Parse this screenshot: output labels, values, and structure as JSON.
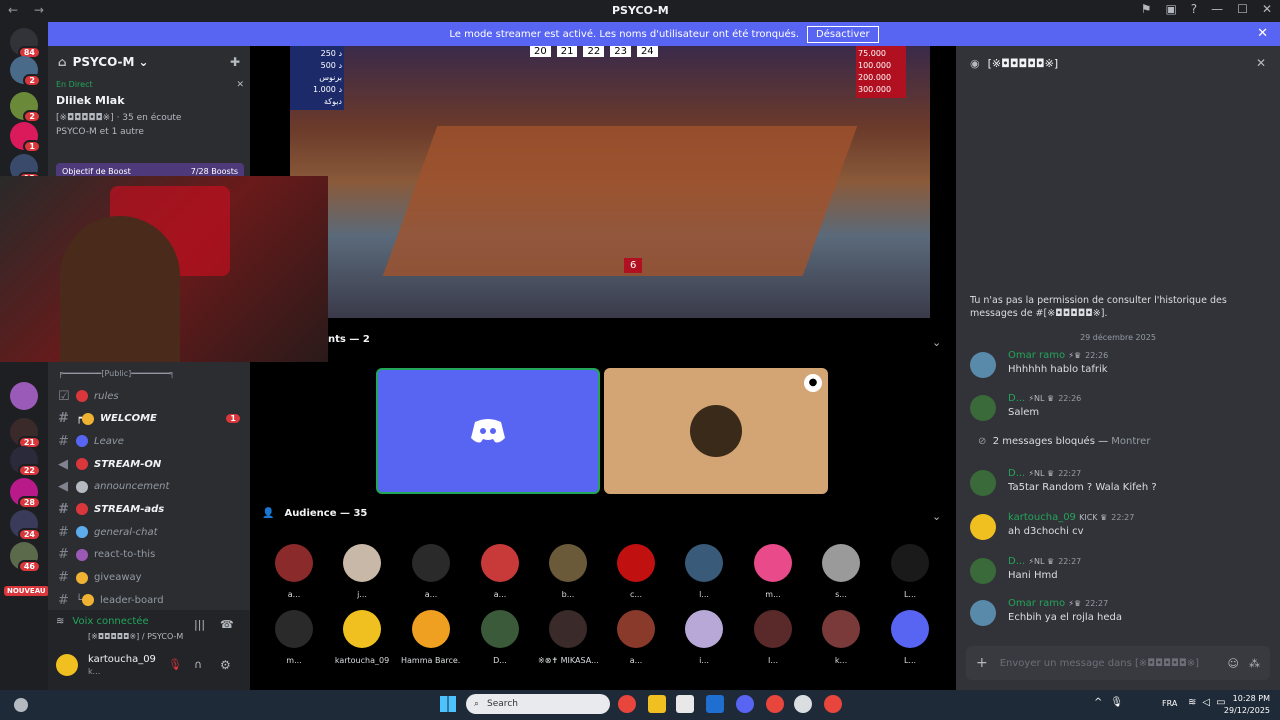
{
  "window": {
    "title": "PSYCO-M",
    "back": "←",
    "forward": "→"
  },
  "banner": {
    "text": "Le mode streamer est activé. Les noms d'utilisateur ont été tronqués.",
    "button": "Désactiver"
  },
  "guild_badges": [
    "84",
    "2",
    "2",
    "1",
    "13",
    "21",
    "22",
    "28",
    "24",
    "46"
  ],
  "guild_new_label": "NOUVEAU",
  "server": {
    "name": "PSYCO-M",
    "live_label": "En Direct",
    "event_title": "Dlilek Mlak",
    "event_channel": "[※◘◘◘◘◘※]",
    "listening": "35 en écoute",
    "hosts": "PSYCO-M et 1 autre",
    "boost_label": "Objectif de Boost",
    "boost_count": "7/28 Boosts"
  },
  "channels": [
    {
      "prefix": "╒━━━━━━━━[Public]━━━━━━━━╕",
      "label": "",
      "type": "category"
    },
    {
      "prefix": "",
      "label": "rules",
      "emoji_color": "#da373c",
      "type": "rules"
    },
    {
      "prefix": "┍",
      "label": "WELCOME",
      "emoji_color": "#f0b232",
      "bold": true,
      "ping": "1"
    },
    {
      "prefix": "",
      "label": "Leave",
      "emoji_color": "#5865f2"
    },
    {
      "prefix": "",
      "label": "STREAM-ON",
      "emoji_color": "#da373c",
      "bold": true,
      "type": "announce"
    },
    {
      "prefix": "",
      "label": "announcement",
      "emoji_color": "#b5bac1",
      "type": "announce"
    },
    {
      "prefix": "",
      "label": "STREAM-ads",
      "emoji_color": "#da373c",
      "bold": true
    },
    {
      "prefix": "",
      "label": "general-chat",
      "emoji_color": "#5dadec"
    },
    {
      "prefix": "",
      "label": "react-to-this",
      "emoji_color": "#9b59b6"
    },
    {
      "prefix": "",
      "label": "giveaway",
      "emoji_color": "#f0b232"
    },
    {
      "prefix": "└",
      "label": "leader-board",
      "emoji_color": "#f0b232"
    }
  ],
  "voice": {
    "status": "Voix connectée",
    "channel": "[※◘◘◘◘◘※] / PSYCO-M"
  },
  "user": {
    "name": "kartoucha_09",
    "status": "k..."
  },
  "stream": {
    "left_scores": [
      "250 د",
      "500 د",
      "برنوس",
      "1.000 د",
      "دبوكة"
    ],
    "right_scores": [
      "75.000",
      "100.000",
      "200.000",
      "300.000"
    ],
    "numbers": [
      "20",
      "21",
      "22",
      "23",
      "24"
    ],
    "podium": "6"
  },
  "participants_label": "nts — 2",
  "audience_label": "Audience — 35",
  "audience": [
    {
      "name": "a...",
      "color": "#8a2a2a"
    },
    {
      "name": "j...",
      "color": "#c8b8a8"
    },
    {
      "name": "a...",
      "color": "#2a2a2a"
    },
    {
      "name": "a...",
      "color": "#c83a3a"
    },
    {
      "name": "b...",
      "color": "#6a5a3a"
    },
    {
      "name": "c...",
      "color": "#c01010"
    },
    {
      "name": "l...",
      "color": "#3a5a7a"
    },
    {
      "name": "m...",
      "color": "#e84a8a"
    },
    {
      "name": "s...",
      "color": "#9a9a9a"
    },
    {
      "name": "L...",
      "color": "#1a1a1a"
    },
    {
      "name": "m...",
      "color": "#2a2a2a"
    },
    {
      "name": "kartoucha_09",
      "color": "#f0c020"
    },
    {
      "name": "Hamma Barce...",
      "color": "#f0a020"
    },
    {
      "name": "D...",
      "color": "#3a5a3a"
    },
    {
      "name": "※⊗✝ MIKASA...",
      "color": "#3a2a2a"
    },
    {
      "name": "a...",
      "color": "#8a3a2a"
    },
    {
      "name": "i...",
      "color": "#b8a8d8"
    },
    {
      "name": "I...",
      "color": "#5a2a2a"
    },
    {
      "name": "k...",
      "color": "#7a3a3a"
    },
    {
      "name": "L...",
      "color": "#5865f2"
    }
  ],
  "chat": {
    "channel": "[※◘◘◘◘◘※]",
    "permission": "Tu n'as pas la permission de consulter l'historique des messages de #[※◘◘◘◘◘※].",
    "date": "29 décembre 2025",
    "messages": [
      {
        "author": "Omar ramo",
        "author_color": "#23a55a",
        "tags": "⚡♛",
        "time": "22:26",
        "text": "Hhhhhh hablo tafrik",
        "av": "#5a8aaa"
      },
      {
        "author": "D...",
        "author_color": "#23a55a",
        "tags": "⚡NL ♛",
        "time": "22:26",
        "text": "Salem",
        "av": "#3a6a3a"
      },
      {
        "author": "D...",
        "author_color": "#23a55a",
        "tags": "⚡NL ♛",
        "time": "22:27",
        "text": "Ta5tar Random ? Wala Kifeh ?",
        "av": "#3a6a3a"
      },
      {
        "author": "kartoucha_09",
        "author_color": "#23a55a",
        "tags": "KICK ♛",
        "time": "22:27",
        "text": "ah d3chochi cv",
        "av": "#f0c020"
      },
      {
        "author": "D...",
        "author_color": "#23a55a",
        "tags": "⚡NL ♛",
        "time": "22:27",
        "text": "Hani Hmd",
        "av": "#3a6a3a"
      },
      {
        "author": "Omar ramo",
        "author_color": "#23a55a",
        "tags": "⚡♛",
        "time": "22:27",
        "text": "Echbih ya el rojla heda",
        "av": "#5a8aaa"
      }
    ],
    "blocked": "2 messages bloqués",
    "show": "Montrer",
    "input_placeholder": "Envoyer un message dans [※◘◘◘◘◘※]"
  },
  "taskbar": {
    "search": "Search",
    "lang": "FRA",
    "time": "10:28 PM",
    "date": "29/12/2025"
  }
}
